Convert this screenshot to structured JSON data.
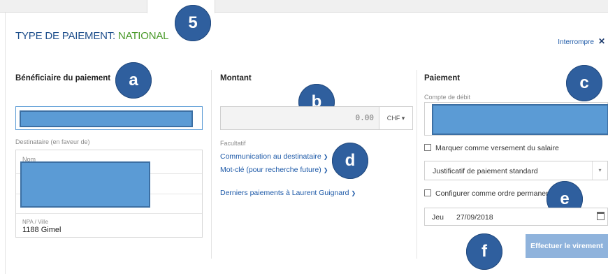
{
  "header": {
    "title_prefix": "TYPE DE PAIEMENT: ",
    "title_type": "NATIONAL",
    "abort_label": "Interrompre",
    "abort_icon": "close-icon"
  },
  "badges": {
    "step": "5",
    "a": "a",
    "b": "b",
    "c": "c",
    "d": "d",
    "e": "e",
    "f": "f"
  },
  "beneficiary": {
    "section_title": "Bénéficiaire du paiement",
    "recipient_label": "Destinataire (en faveur de)",
    "name_label": "Nom",
    "city_label": "NPA / Ville",
    "city_value": "1188 Gimel"
  },
  "amount": {
    "section_title": "Montant",
    "value": "0.00",
    "currency": "CHF",
    "optional_label": "Facultatif",
    "link_communication": "Communication au destinataire",
    "link_keyword": "Mot-clé (pour recherche future)",
    "link_recent": "Derniers paiements à Laurent Guignard"
  },
  "payment": {
    "section_title": "Paiement",
    "debit_account_label": "Compte de débit",
    "salary_checkbox_label": "Marquer comme versement du salaire",
    "salary_checked": false,
    "receipt_select_value": "Justificatif de paiement standard",
    "standing_order_label": "Configurer comme ordre permanent",
    "standing_order_checked": false,
    "date_day": "Jeu",
    "date_value": "27/09/2018",
    "submit_label": "Effectuer le virement"
  },
  "colors": {
    "badge": "#2f5f9e",
    "title_blue": "#1e4f8c",
    "title_green": "#4a9a2a",
    "link": "#1e5aa8",
    "redaction": "#5b9bd5",
    "button_disabled": "#8fb3dc"
  }
}
